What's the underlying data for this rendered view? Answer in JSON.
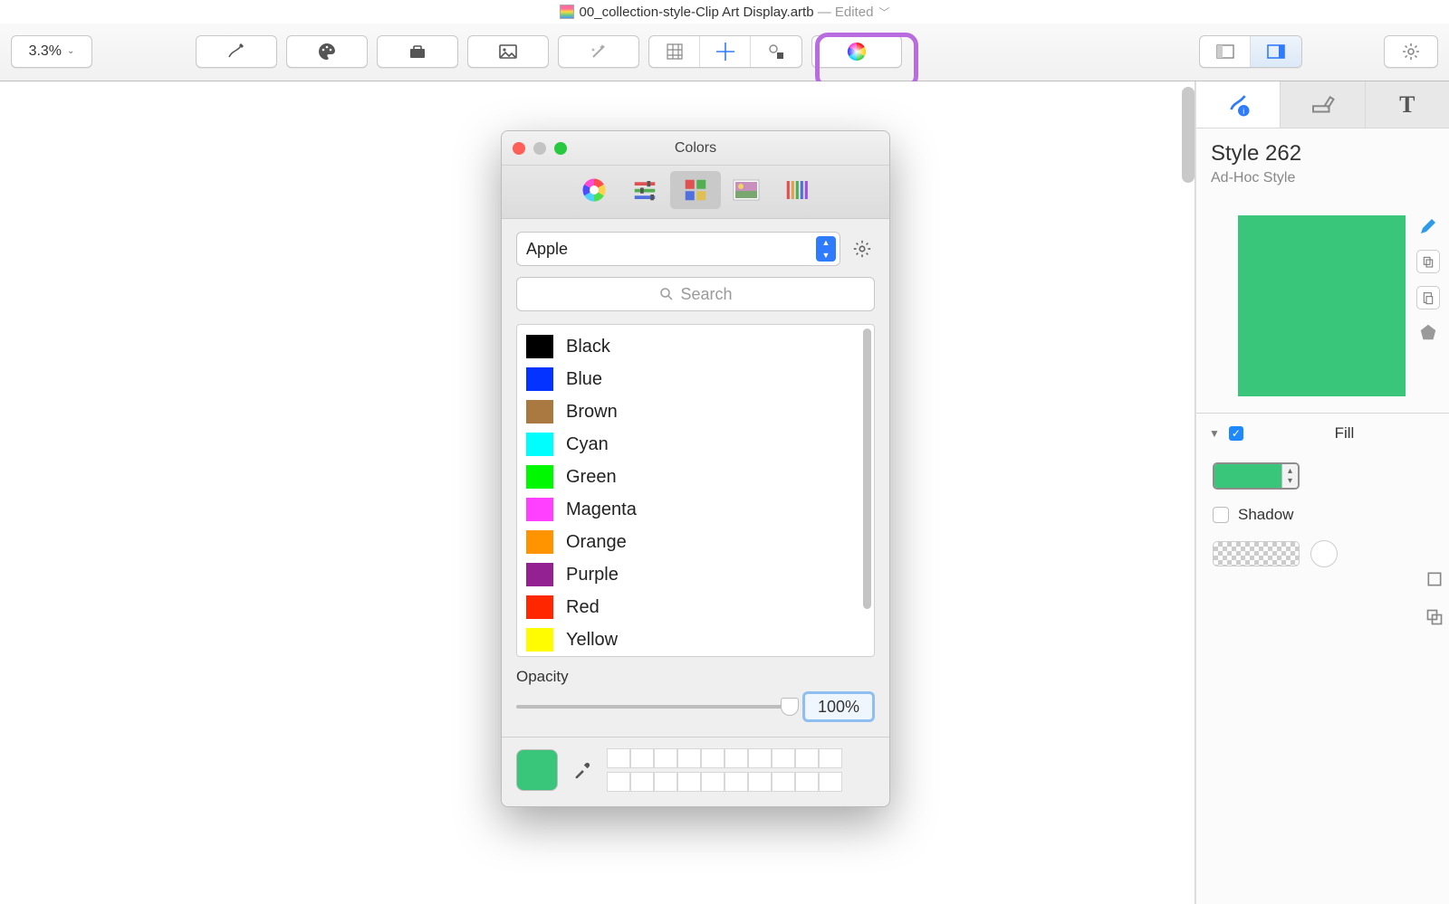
{
  "titlebar": {
    "filename": "00_collection-style-Clip Art Display.artb",
    "edited_suffix": " — Edited"
  },
  "toolbar": {
    "zoom": "3.3%"
  },
  "inspector": {
    "style_title": "Style 262",
    "style_subtitle": "Ad-Hoc Style",
    "fill_label": "Fill",
    "shadow_label": "Shadow",
    "swatch_color": "#39c67b"
  },
  "colors_panel": {
    "title": "Colors",
    "palette_select": "Apple",
    "search_placeholder": "Search",
    "opacity_label": "Opacity",
    "opacity_value": "100%",
    "current_color": "#39c67b",
    "list": [
      {
        "name": "Black",
        "hex": "#000000"
      },
      {
        "name": "Blue",
        "hex": "#0433ff"
      },
      {
        "name": "Brown",
        "hex": "#aa7942"
      },
      {
        "name": "Cyan",
        "hex": "#00fdff"
      },
      {
        "name": "Green",
        "hex": "#00f900"
      },
      {
        "name": "Magenta",
        "hex": "#ff40ff"
      },
      {
        "name": "Orange",
        "hex": "#ff9300"
      },
      {
        "name": "Purple",
        "hex": "#942192"
      },
      {
        "name": "Red",
        "hex": "#ff2600"
      },
      {
        "name": "Yellow",
        "hex": "#fffb00"
      }
    ]
  }
}
